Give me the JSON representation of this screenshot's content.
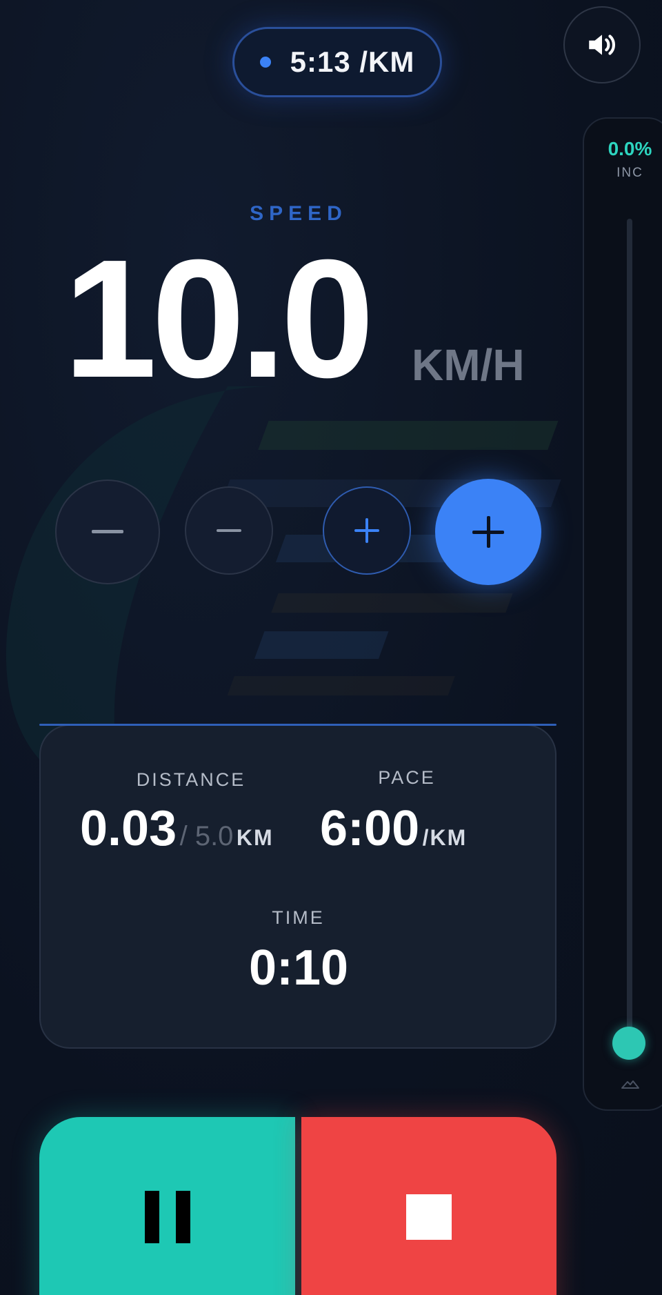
{
  "header": {
    "pace_display": "5:13 /KM"
  },
  "incline": {
    "value": "0.0%",
    "label": "INC",
    "level": 0.0
  },
  "speed": {
    "label": "SPEED",
    "value": "10.0",
    "unit": "KM/H"
  },
  "stats": {
    "distance": {
      "label": "DISTANCE",
      "value": "0.03",
      "target": "/ 5.0",
      "unit": "KM"
    },
    "pace": {
      "label": "PACE",
      "value": "6:00",
      "unit": "/KM"
    },
    "time": {
      "label": "TIME",
      "value": "0:10"
    }
  },
  "colors": {
    "accent_blue": "#3b82f6",
    "teal": "#1ec8b4",
    "red": "#ef4444",
    "background": "#0b1220"
  },
  "icons": {
    "sound": "speaker-icon",
    "minus": "minus-icon",
    "plus": "plus-icon",
    "pause": "pause-icon",
    "stop": "stop-icon",
    "mountain": "mountain-icon"
  }
}
